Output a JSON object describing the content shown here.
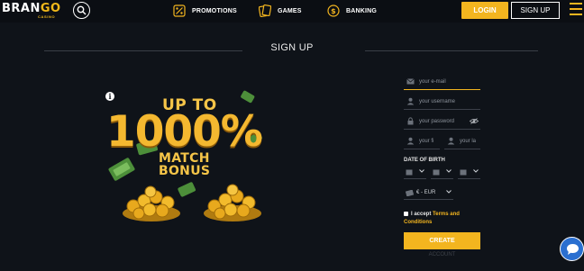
{
  "header": {
    "logo_main": "BRANGO",
    "logo_sub": "CASINO",
    "nav": [
      {
        "label": "PROMOTIONS",
        "icon": "percent-icon"
      },
      {
        "label": "GAMES",
        "icon": "cards-icon"
      },
      {
        "label": "BANKING",
        "icon": "dollar-coin-icon"
      }
    ],
    "login_label": "LOGIN",
    "signup_label": "SIGN UP"
  },
  "page_title": "SIGN UP",
  "promo": {
    "line1": "UP TO",
    "line2": "1000%",
    "line3": "MATCH",
    "line4": "BONUS"
  },
  "form": {
    "email_placeholder": "your e-mail",
    "username_placeholder": "your username",
    "password_placeholder": "your password",
    "firstname_placeholder": "your fi",
    "lastname_placeholder": "your la",
    "dob_label": "DATE OF BIRTH",
    "currency_value": "€ - EUR",
    "accept_prefix": "I accept",
    "accept_terms": "Terms and",
    "accept_conditions": "Conditions",
    "create_label": "CREATE",
    "account_text": "ACCOUNT"
  },
  "colors": {
    "accent": "#f3b51f",
    "background": "#0f1319",
    "chat": "#2a6fd0"
  }
}
